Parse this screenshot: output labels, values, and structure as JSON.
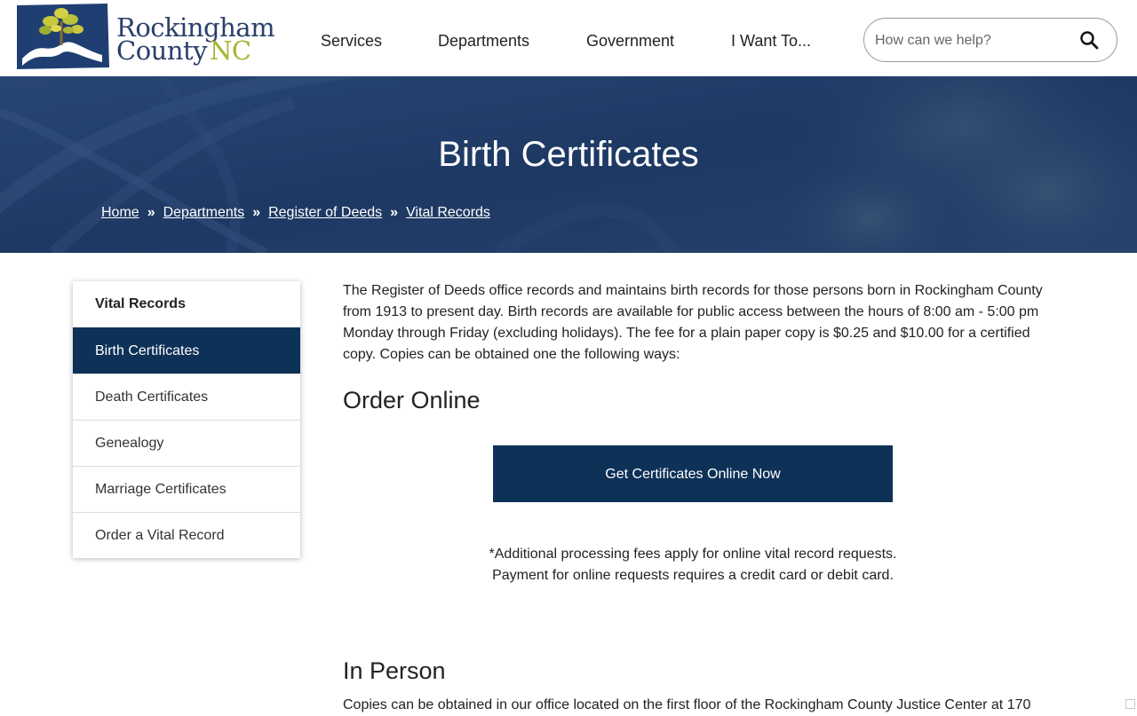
{
  "logo": {
    "line1": "Rockingham",
    "line2": "County",
    "nc": "NC"
  },
  "nav": {
    "items": [
      {
        "label": "Services"
      },
      {
        "label": "Departments"
      },
      {
        "label": "Government"
      },
      {
        "label": "I Want To..."
      }
    ]
  },
  "search": {
    "placeholder": "How can we help?",
    "icon": "search-icon"
  },
  "banner": {
    "title": "Birth Certificates",
    "breadcrumb": [
      {
        "label": "Home"
      },
      {
        "label": "Departments"
      },
      {
        "label": "Register of Deeds"
      },
      {
        "label": "Vital Records"
      }
    ],
    "separator": "»"
  },
  "sidebar": {
    "heading": "Vital Records",
    "items": [
      {
        "label": "Birth Certificates",
        "active": true
      },
      {
        "label": "Death Certificates"
      },
      {
        "label": "Genealogy"
      },
      {
        "label": "Marriage Certificates"
      },
      {
        "label": "Order a Vital Record"
      }
    ]
  },
  "main": {
    "intro": "The Register of Deeds office records and maintains birth records for those persons born in Rockingham County from 1913 to present day. Birth records are available for public access between the hours of 8:00 am - 5:00 pm Monday through Friday (excluding holidays). The fee for a plain paper copy is $0.25 and $10.00 for a certified copy. Copies can be obtained one the following ways:",
    "order_online_heading": "Order Online",
    "cta_label": "Get Certificates Online Now",
    "note_line1": "*Additional processing fees apply for online vital record requests.",
    "note_line2": "Payment for online requests requires a credit card or debit card.",
    "in_person_heading": "In Person",
    "in_person_text": "Copies can be obtained in our office located on the first floor of the Rockingham County Justice Center at 170"
  },
  "colors": {
    "brand_navy": "#0e3157",
    "banner_blue": "#1f3a66",
    "logo_green": "#a7b432"
  }
}
